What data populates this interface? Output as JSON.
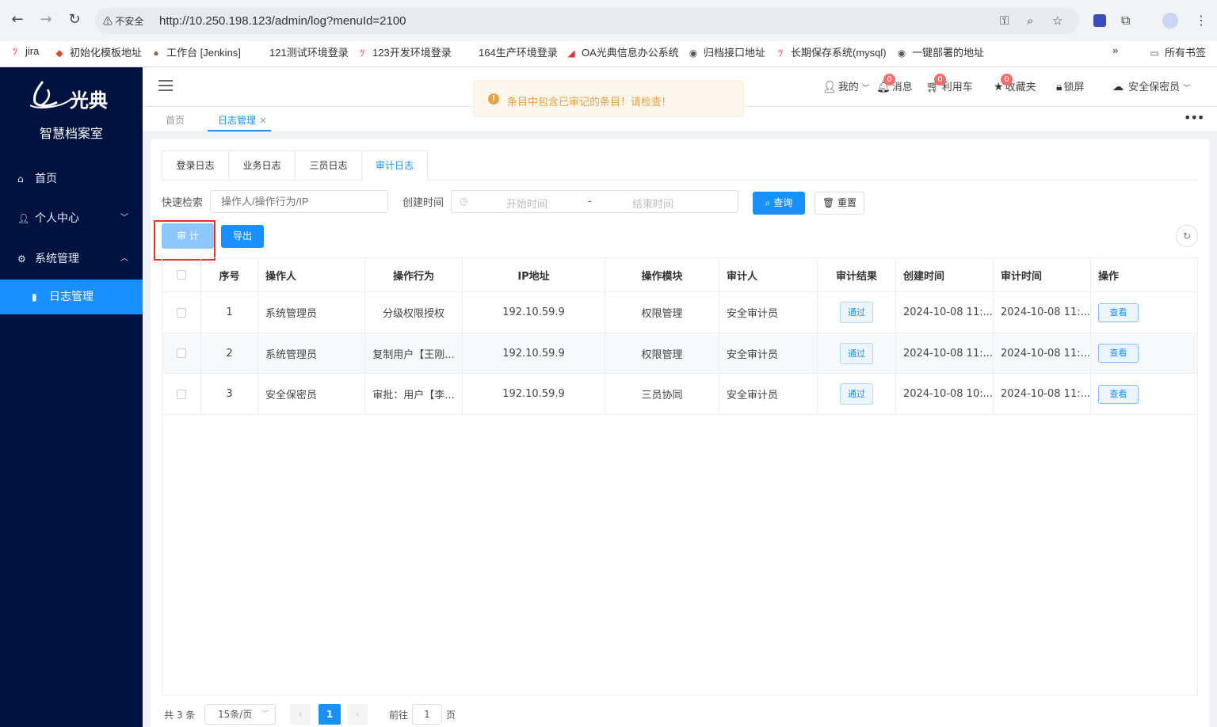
{
  "browser": {
    "warning": "不安全",
    "url": "http://10.250.198.123/admin/log?menuId=2100",
    "bookmarks": [
      "jira",
      "初始化模板地址",
      "工作台 [Jenkins]",
      "121测试环境登录",
      "123开发环境登录",
      "164生产环境登录",
      "OA光典信息办公系统",
      "归档接口地址",
      "长期保存系统(mysql)",
      "一键部署的地址"
    ],
    "all_bookmarks": "所有书签",
    "more": "»"
  },
  "sidebar": {
    "brand": "光典",
    "subtitle": "智慧档案室",
    "items": [
      {
        "label": "首页",
        "icon": "home-icon"
      },
      {
        "label": "个人中心",
        "icon": "user-icon"
      },
      {
        "label": "系统管理",
        "icon": "gear-icon"
      },
      {
        "label": "日志管理",
        "icon": "bar-chart-icon"
      }
    ]
  },
  "header": {
    "my": "我的",
    "messages": "消息",
    "messages_count": "0",
    "cart": "利用车",
    "cart_count": "0",
    "favorites": "收藏夹",
    "favorites_count": "0",
    "lock": "锁屏",
    "user": "安全保密员"
  },
  "tagsbar": {
    "home": "首页",
    "current": "日志管理",
    "close": "×",
    "more": "•••"
  },
  "toast": {
    "message": "条目中包含已审记的条目！请检查!"
  },
  "tabs": [
    "登录日志",
    "业务日志",
    "三员日志",
    "审计日志"
  ],
  "filter": {
    "quick_label": "快速检索",
    "quick_placeholder": "操作人/操作行为/IP",
    "time_label": "创建时间",
    "start_placeholder": "开始时间",
    "separator": "-",
    "end_placeholder": "结束时间",
    "search": "查询",
    "reset": "重置"
  },
  "actions": {
    "audit": "审 计",
    "export": "导出"
  },
  "table": {
    "headers": [
      "序号",
      "操作人",
      "操作行为",
      "IP地址",
      "操作模块",
      "审计人",
      "审计结果",
      "创建时间",
      "审计时间",
      "操作"
    ],
    "rows": [
      {
        "no": "1",
        "operator": "系统管理员",
        "action": "分级权限授权",
        "ip": "192.10.59.9",
        "module": "权限管理",
        "auditor": "安全审计员",
        "result": "通过",
        "created": "2024-10-08 11:...",
        "audited": "2024-10-08 11:...",
        "op": "查看"
      },
      {
        "no": "2",
        "operator": "系统管理员",
        "action": "复制用户【王刚...",
        "ip": "192.10.59.9",
        "module": "权限管理",
        "auditor": "安全审计员",
        "result": "通过",
        "created": "2024-10-08 11:...",
        "audited": "2024-10-08 11:...",
        "op": "查看"
      },
      {
        "no": "3",
        "operator": "安全保密员",
        "action": "审批：用户【李...",
        "ip": "192.10.59.9",
        "module": "三员协同",
        "auditor": "安全审计员",
        "result": "通过",
        "created": "2024-10-08 10:...",
        "audited": "2024-10-08 11:...",
        "op": "查看"
      }
    ]
  },
  "pagination": {
    "total": "共 3 条",
    "page_size": "15条/页",
    "current": "1",
    "goto": "前往",
    "goto_value": "1",
    "page_unit": "页"
  }
}
